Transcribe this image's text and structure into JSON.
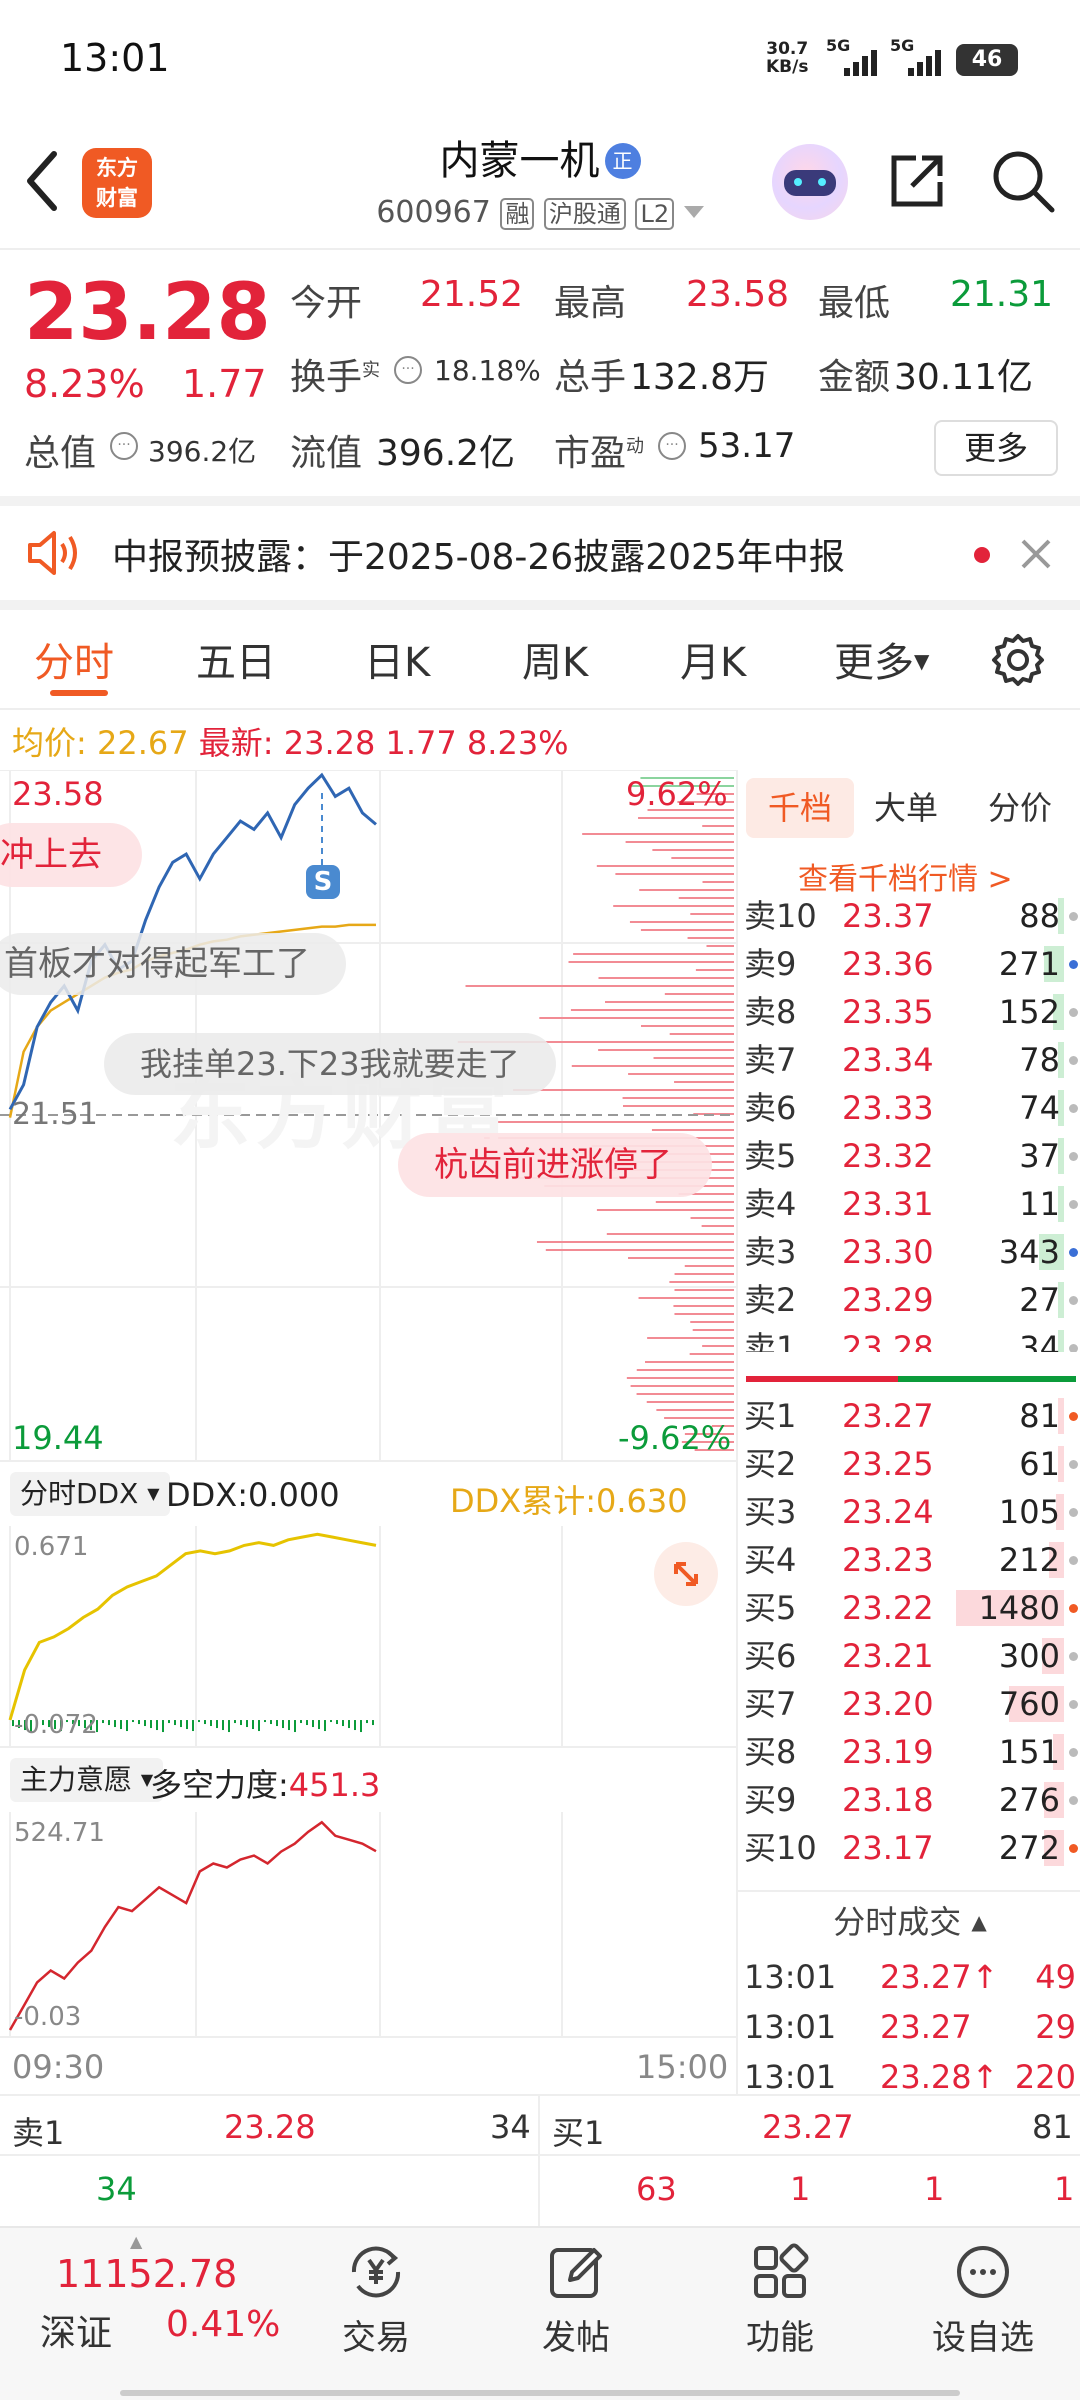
{
  "status_bar": {
    "time": "13:01",
    "net_speed": "30.7",
    "net_unit": "KB/s",
    "sig1": "5G",
    "sig2": "5G",
    "battery": "46"
  },
  "header": {
    "brand_line1": "东方",
    "brand_line2": "财富",
    "stock_name": "内蒙一机",
    "name_badge": "正",
    "code": "600967",
    "tags": [
      "融",
      "沪股通",
      "L2"
    ]
  },
  "quote": {
    "price": "23.28",
    "pct": "8.23%",
    "chg": "1.77",
    "fields": [
      {
        "label": "今开",
        "value": "21.52",
        "tone": "red"
      },
      {
        "label": "最高",
        "value": "23.58",
        "tone": "red"
      },
      {
        "label": "最低",
        "value": "21.31",
        "tone": "green"
      },
      {
        "label": "换手",
        "sup": "实",
        "value": "18.18%",
        "tone": "dark"
      },
      {
        "label": "总手",
        "value": "132.8万",
        "tone": "dark"
      },
      {
        "label": "金额",
        "value": "30.11亿",
        "tone": "dark"
      },
      {
        "label": "总值",
        "value": "396.2亿",
        "tone": "dark"
      },
      {
        "label": "流值",
        "value": "396.2亿",
        "tone": "dark"
      },
      {
        "label": "市盈",
        "sup": "动",
        "value": "53.17",
        "tone": "dark"
      }
    ],
    "more_btn": "更多"
  },
  "notice": {
    "text": "中报预披露：于2025-08-26披露2025年中报"
  },
  "tabs": [
    "分时",
    "五日",
    "日K",
    "周K",
    "月K",
    "更多"
  ],
  "avg_line": {
    "avg_label": "均价:",
    "avg_value": "22.67",
    "new_label": "最新:",
    "new_value": "23.28",
    "chg": "1.77",
    "pct": "8.23%"
  },
  "chart": {
    "high_label": "23.58",
    "low_label": "19.44",
    "pre_close_label": "21.51",
    "up_pct": "9.62%",
    "down_pct": "-9.62%",
    "comments": [
      "冲上去",
      "首板才对得起军工了",
      "我挂单23.下23我就要走了",
      "杭齿前进涨停了"
    ],
    "s_badge": "S",
    "time_start": "09:30",
    "time_end": "15:00"
  },
  "chart_data": {
    "type": "line",
    "title": "分时",
    "series": [
      {
        "name": "价格",
        "values": [
          21.55,
          21.7,
          22.05,
          22.2,
          22.3,
          22.15,
          22.45,
          22.55,
          22.4,
          22.45,
          22.7,
          22.9,
          23.05,
          23.1,
          22.95,
          23.1,
          23.2,
          23.3,
          23.25,
          23.35,
          23.2,
          23.4,
          23.5,
          23.58,
          23.45,
          23.5,
          23.35,
          23.28
        ]
      },
      {
        "name": "均价",
        "values": [
          21.5,
          21.9,
          22.05,
          22.15,
          22.2,
          22.25,
          22.3,
          22.35,
          22.38,
          22.4,
          22.45,
          22.48,
          22.5,
          22.52,
          22.55,
          22.57,
          22.58,
          22.6,
          22.61,
          22.62,
          22.63,
          22.64,
          22.65,
          22.66,
          22.66,
          22.67,
          22.67,
          22.67
        ]
      }
    ],
    "ylim": [
      19.44,
      23.58
    ]
  },
  "ddx": {
    "select": "分时DDX",
    "value_label": "DDX:0.000",
    "sum_label": "DDX累计:0.630",
    "top": "0.671",
    "bottom": "-0.072"
  },
  "main_force": {
    "select": "主力意愿",
    "label": "多空力度:",
    "value": "451.3",
    "top": "524.71",
    "bottom": "-0.03"
  },
  "orderbook": {
    "tabs": [
      "千档",
      "大单",
      "分价"
    ],
    "link": "查看千档行情 >",
    "asks": [
      {
        "label": "卖10",
        "price": "23.37",
        "vol": "88"
      },
      {
        "label": "卖9",
        "price": "23.36",
        "vol": "271"
      },
      {
        "label": "卖8",
        "price": "23.35",
        "vol": "152"
      },
      {
        "label": "卖7",
        "price": "23.34",
        "vol": "78"
      },
      {
        "label": "卖6",
        "price": "23.33",
        "vol": "74"
      },
      {
        "label": "卖5",
        "price": "23.32",
        "vol": "37"
      },
      {
        "label": "卖4",
        "price": "23.31",
        "vol": "11"
      },
      {
        "label": "卖3",
        "price": "23.30",
        "vol": "343"
      },
      {
        "label": "卖2",
        "price": "23.29",
        "vol": "27"
      },
      {
        "label": "卖1",
        "price": "23.28",
        "vol": "34"
      }
    ],
    "bids": [
      {
        "label": "买1",
        "price": "23.27",
        "vol": "81"
      },
      {
        "label": "买2",
        "price": "23.25",
        "vol": "61"
      },
      {
        "label": "买3",
        "price": "23.24",
        "vol": "105"
      },
      {
        "label": "买4",
        "price": "23.23",
        "vol": "212"
      },
      {
        "label": "买5",
        "price": "23.22",
        "vol": "1480"
      },
      {
        "label": "买6",
        "price": "23.21",
        "vol": "300"
      },
      {
        "label": "买7",
        "price": "23.20",
        "vol": "760"
      },
      {
        "label": "买8",
        "price": "23.19",
        "vol": "151"
      },
      {
        "label": "买9",
        "price": "23.18",
        "vol": "276"
      },
      {
        "label": "买10",
        "price": "23.17",
        "vol": "272"
      }
    ],
    "trades_title": "分时成交",
    "trades": [
      {
        "time": "13:01",
        "price": "23.27",
        "arrow": "↑",
        "vol": "49"
      },
      {
        "time": "13:01",
        "price": "23.27",
        "arrow": "",
        "vol": "29"
      },
      {
        "time": "13:01",
        "price": "23.28",
        "arrow": "↑",
        "vol": "220"
      }
    ]
  },
  "level1": {
    "ask_label": "卖1",
    "ask_price": "23.28",
    "ask_vol": "34",
    "bid_label": "买1",
    "bid_price": "23.27",
    "bid_vol": "81",
    "queue_left": [
      "34"
    ],
    "queue_right": [
      "63",
      "1",
      "1",
      "1"
    ]
  },
  "bottom_bar": {
    "index_value": "11152.78",
    "index_name": "深证",
    "index_pct": "0.41%",
    "items": [
      {
        "label": "交易",
        "icon": "yen-exchange-icon"
      },
      {
        "label": "发帖",
        "icon": "edit-icon"
      },
      {
        "label": "功能",
        "icon": "grid-icon"
      },
      {
        "label": "设自选",
        "icon": "more-icon"
      }
    ]
  },
  "colors": {
    "up": "#e2233a",
    "down": "#0b9b3a",
    "accent": "#f05a24",
    "avg": "#e6a817",
    "price_line": "#2f66b3"
  }
}
